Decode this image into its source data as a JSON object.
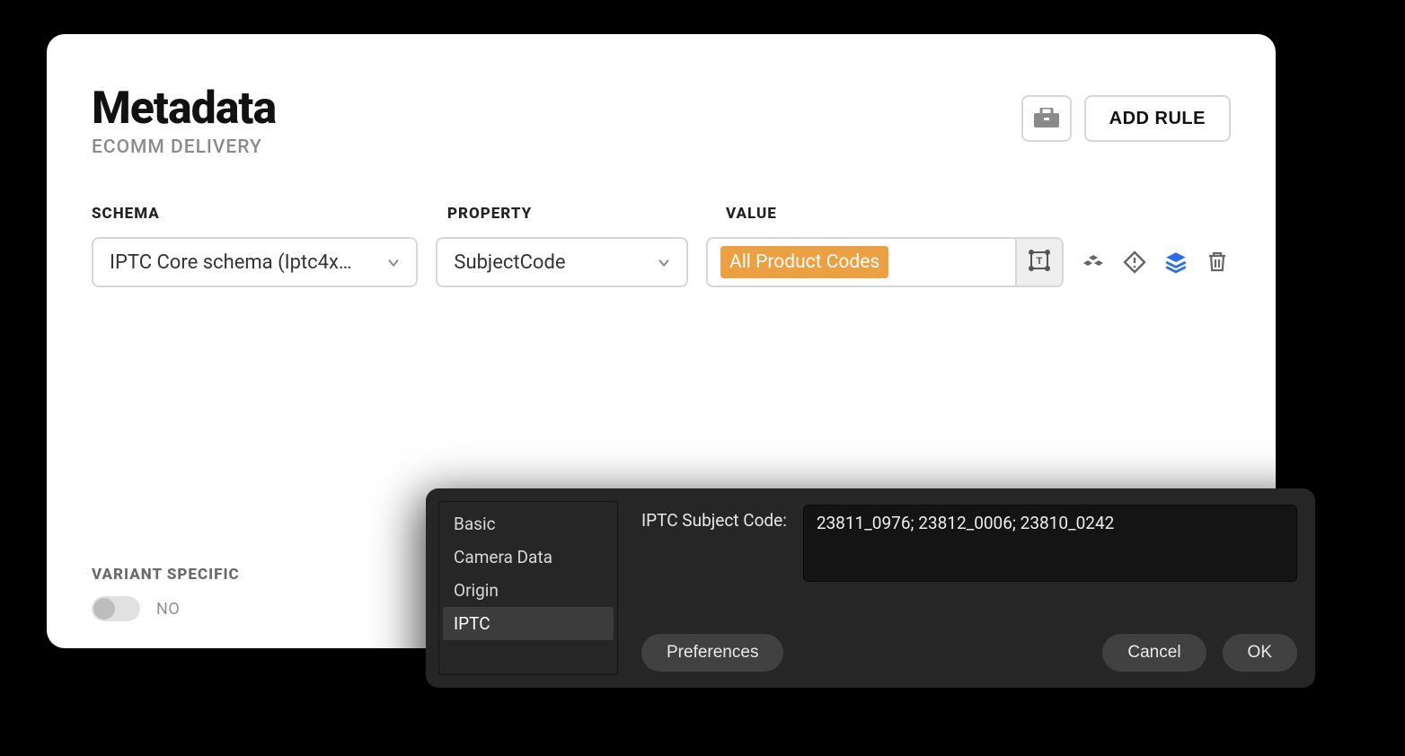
{
  "page": {
    "title": "Metadata",
    "subtitle": "ECOMM DELIVERY"
  },
  "header_actions": {
    "toolbox_icon": "toolbox",
    "add_rule_label": "ADD RULE"
  },
  "columns": {
    "schema_label": "SCHEMA",
    "property_label": "PROPERTY",
    "value_label": "VALUE"
  },
  "row": {
    "schema_selected": "IPTC Core schema (Iptc4x…",
    "property_selected": "SubjectCode",
    "value_chip": "All Product Codes"
  },
  "row_icons": {
    "text_transform": "text-transform",
    "cubes": "data-source",
    "warning_diamond": "warning",
    "layers": "layers",
    "trash": "delete"
  },
  "footer": {
    "label": "VARIANT SPECIFIC",
    "toggle_state": "NO"
  },
  "popup": {
    "sidebar_items": [
      "Basic",
      "Camera Data",
      "Origin",
      "IPTC"
    ],
    "sidebar_selected_index": 3,
    "field_label": "IPTC Subject Code:",
    "field_value": "23811_0976; 23812_0006; 23810_0242",
    "preferences_btn": "Preferences",
    "cancel_btn": "Cancel",
    "ok_btn": "OK"
  }
}
